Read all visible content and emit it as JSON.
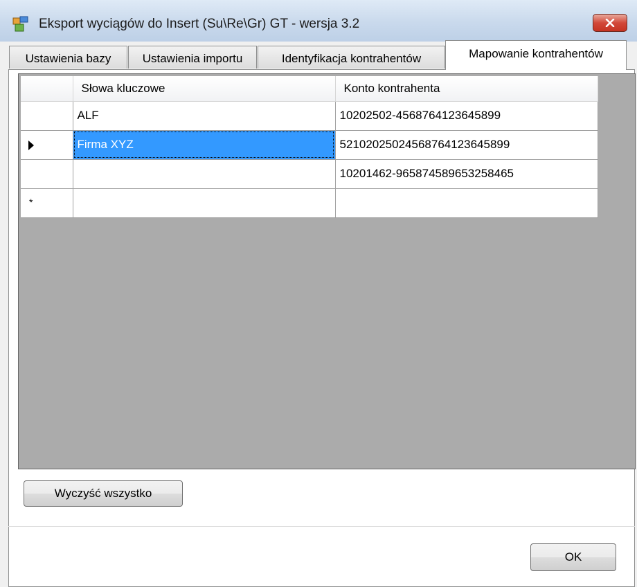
{
  "window": {
    "title": "Eksport wyciągów do Insert (Su\\Re\\Gr) GT - wersja 3.2",
    "icon": "app-window-icon",
    "close_icon": "close-icon"
  },
  "tabs": [
    {
      "label": "Ustawienia bazy",
      "active": false
    },
    {
      "label": "Ustawienia importu",
      "active": false
    },
    {
      "label": "Identyfikacja kontrahentów",
      "active": false
    },
    {
      "label": "Mapowanie kontrahentów",
      "active": true
    }
  ],
  "grid": {
    "columns": [
      "Słowa kluczowe",
      "Konto kontrahenta"
    ],
    "rows": [
      {
        "marker": "",
        "keywords": "ALF",
        "account": "10202502-4568764123645899"
      },
      {
        "marker": "current-row-arrow",
        "keywords": "Firma XYZ",
        "account": "52102025024568764123645899",
        "selected": true
      },
      {
        "marker": "",
        "keywords": "",
        "account": "10201462-965874589653258465"
      },
      {
        "marker": "*",
        "keywords": "",
        "account": "",
        "new_row": true
      }
    ]
  },
  "buttons": {
    "clear_all": "Wyczyść wszystko",
    "ok": "OK"
  },
  "colors": {
    "selection": "#3399ff",
    "grid_background": "#ababab",
    "close_button": "#c53322"
  }
}
